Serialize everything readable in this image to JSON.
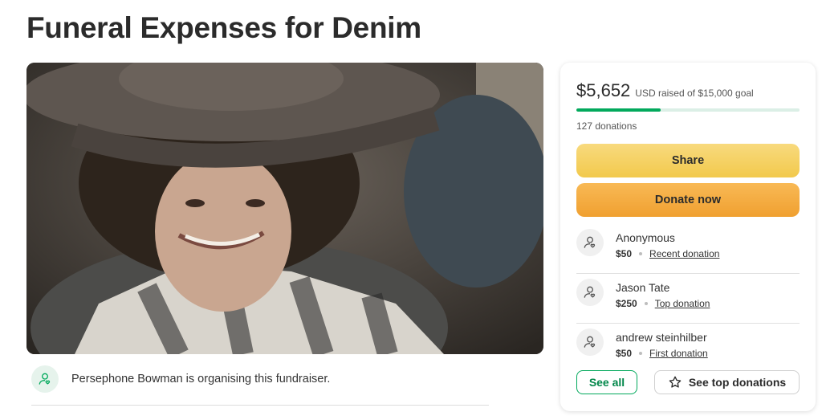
{
  "page": {
    "title": "Funeral Expenses for Denim"
  },
  "hero": {
    "image_icon": "fundraiser-photo"
  },
  "organiser": {
    "text": "Persephone Bowman is organising this fundraiser.",
    "icon": "person-heart-icon"
  },
  "stats": {
    "raised": "$5,652",
    "goal_text": "USD raised of $15,000 goal",
    "progress_fraction": 0.377,
    "donations_count": "127 donations"
  },
  "buttons": {
    "share": "Share",
    "donate": "Donate now",
    "see_all": "See all",
    "see_top": "See top donations"
  },
  "donations": [
    {
      "name": "Anonymous",
      "amount": "$50",
      "tag": "Recent donation"
    },
    {
      "name": "Jason Tate",
      "amount": "$250",
      "tag": "Top donation"
    },
    {
      "name": "andrew steinhilber",
      "amount": "$50",
      "tag": "First donation"
    }
  ],
  "colors": {
    "accent": "#02a95c",
    "share": "#f2c94c",
    "donate": "#f0a030"
  }
}
